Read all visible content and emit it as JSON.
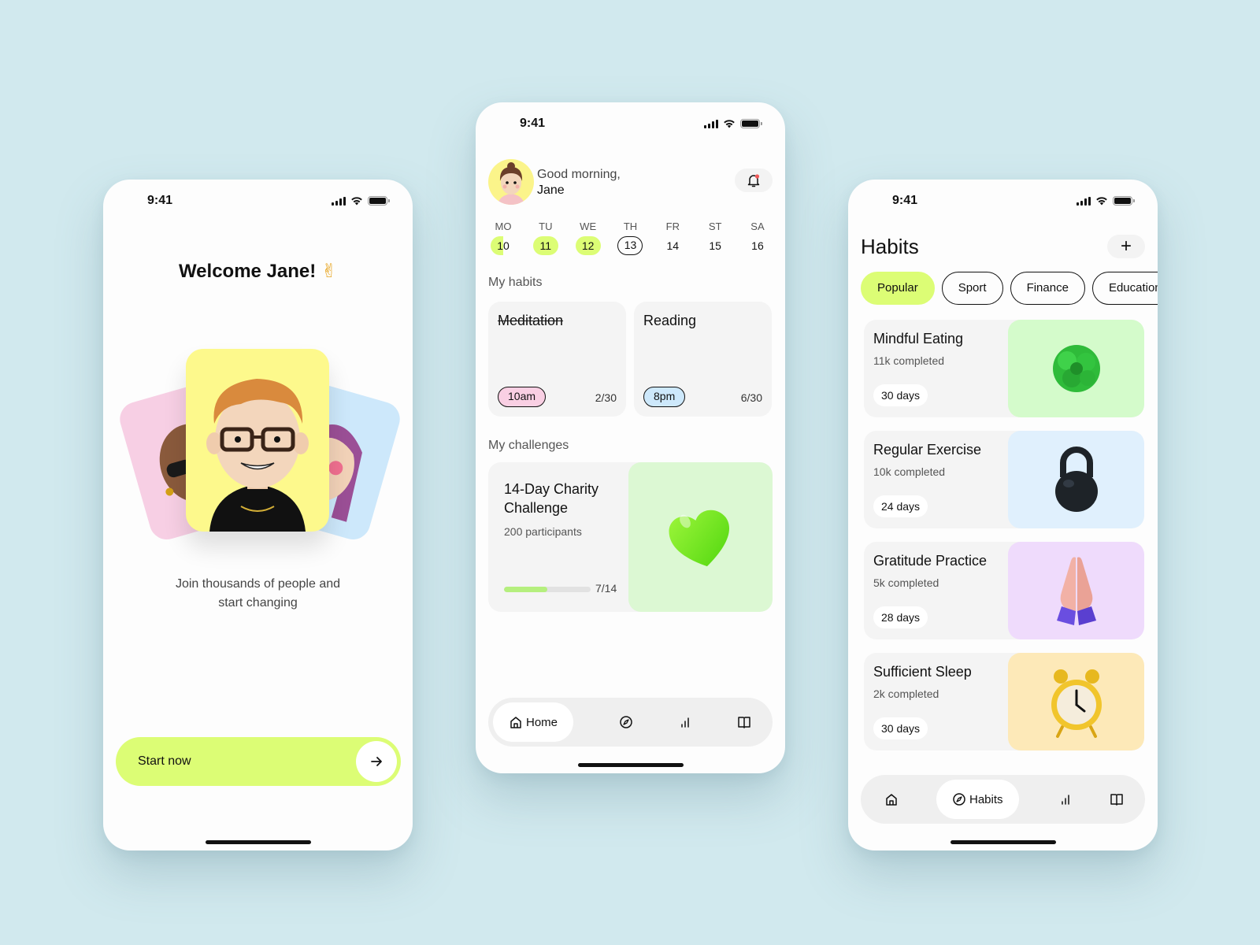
{
  "status_bar": {
    "time": "9:41"
  },
  "onboarding": {
    "title": "Welcome Jane!",
    "title_emoji": "✌",
    "tagline_line1": "Join thousands of people and",
    "tagline_line2": "start changing",
    "start_button_label": "Start now",
    "avatar_cards": [
      "pink",
      "yellow",
      "blue"
    ]
  },
  "home": {
    "greeting": "Good morning,",
    "user_name": "Jane",
    "has_notification": true,
    "week": [
      {
        "day": "MO",
        "date": "10",
        "state": "half"
      },
      {
        "day": "TU",
        "date": "11",
        "state": "done"
      },
      {
        "day": "WE",
        "date": "12",
        "state": "done"
      },
      {
        "day": "TH",
        "date": "13",
        "state": "today"
      },
      {
        "day": "FR",
        "date": "14",
        "state": ""
      },
      {
        "day": "ST",
        "date": "15",
        "state": ""
      },
      {
        "day": "SA",
        "date": "16",
        "state": ""
      }
    ],
    "habits_label": "My habits",
    "habits": [
      {
        "title": "Meditation",
        "completed": true,
        "time": "10am",
        "time_color": "#f9cfe3",
        "progress": "2/30"
      },
      {
        "title": "Reading",
        "completed": false,
        "time": "8pm",
        "time_color": "#cde8fb",
        "progress": "6/30"
      }
    ],
    "challenges_label": "My challenges",
    "challenge": {
      "title": "14-Day Charity Challenge",
      "participants": "200 participants",
      "progress_text": "7/14",
      "progress_fraction": 0.5
    },
    "tabbar": {
      "home": "Home",
      "active": "home"
    }
  },
  "habits_page": {
    "title": "Habits",
    "add_label": "+",
    "categories": [
      {
        "label": "Popular",
        "active": true
      },
      {
        "label": "Sport",
        "active": false
      },
      {
        "label": "Finance",
        "active": false
      },
      {
        "label": "Education",
        "active": false
      }
    ],
    "items": [
      {
        "title": "Mindful Eating",
        "completed": "11k completed",
        "days": "30 days",
        "bg": "#d4fbcb",
        "icon": "broccoli"
      },
      {
        "title": "Regular Exercise",
        "completed": "10k completed",
        "days": "24 days",
        "bg": "#e0f0fd",
        "icon": "kettlebell"
      },
      {
        "title": "Gratitude Practice",
        "completed": "5k completed",
        "days": "28 days",
        "bg": "#efdbfc",
        "icon": "praying-hands"
      },
      {
        "title": "Sufficient Sleep",
        "completed": "2k completed",
        "days": "30 days",
        "bg": "#fde9b8",
        "icon": "alarm-clock"
      }
    ],
    "tabbar": {
      "habits": "Habits",
      "active": "habits"
    }
  },
  "colors": {
    "background": "#d1e9ee",
    "accent": "#dcfd75",
    "progress": "#b5ef7e",
    "notification_dot": "#f05a5a"
  }
}
